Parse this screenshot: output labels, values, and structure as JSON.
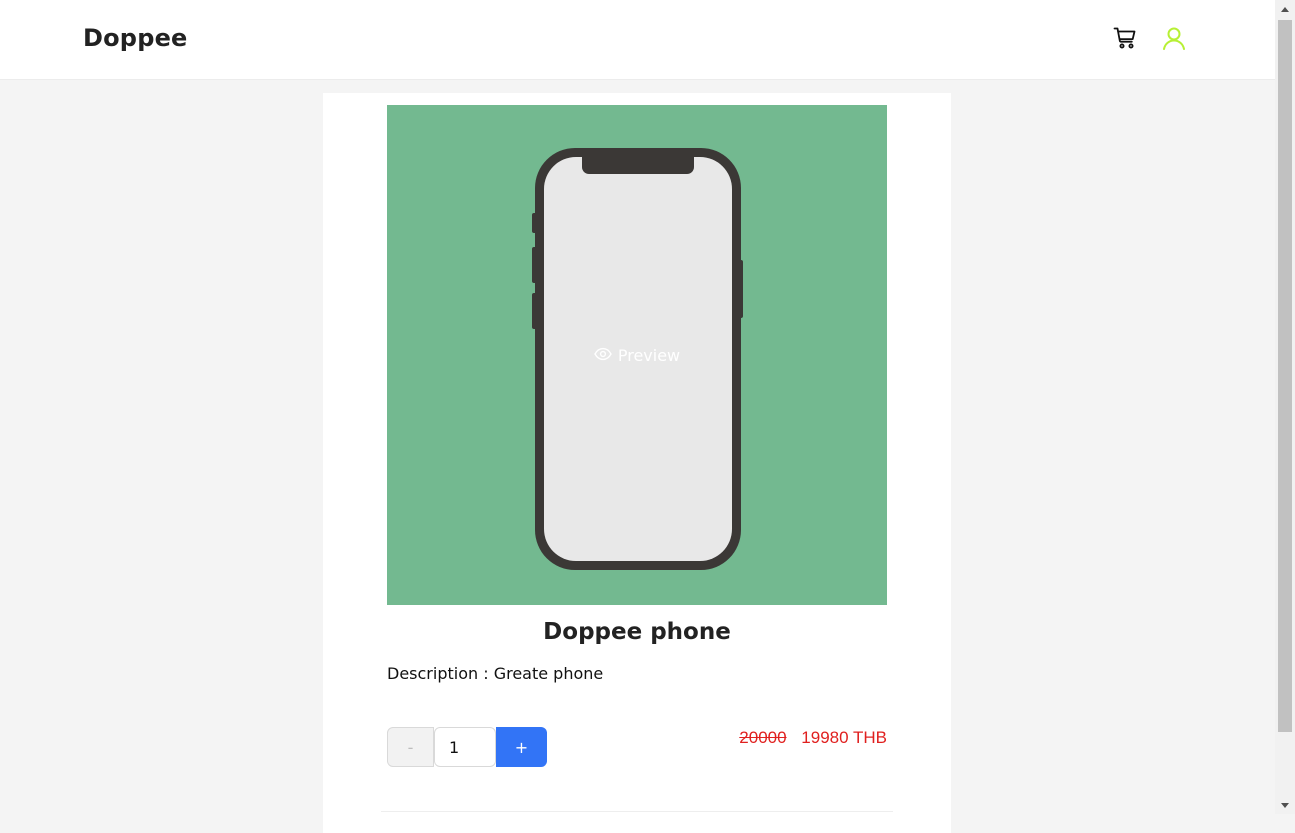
{
  "header": {
    "brand": "Doppee",
    "cart_icon": "shopping-cart-icon",
    "user_icon": "user-icon",
    "user_icon_color": "#b7f035"
  },
  "product": {
    "image_background": "#73b990",
    "preview_label": "Preview",
    "preview_icon": "eye-icon",
    "title": "Doppee phone",
    "description": "Description : Greate phone",
    "quantity": {
      "minus_label": "-",
      "value": "1",
      "plus_label": "+"
    },
    "price": {
      "original": "20000",
      "discounted": "19980 THB",
      "color": "#e0201f"
    }
  },
  "colors": {
    "primary": "#3274f6"
  }
}
